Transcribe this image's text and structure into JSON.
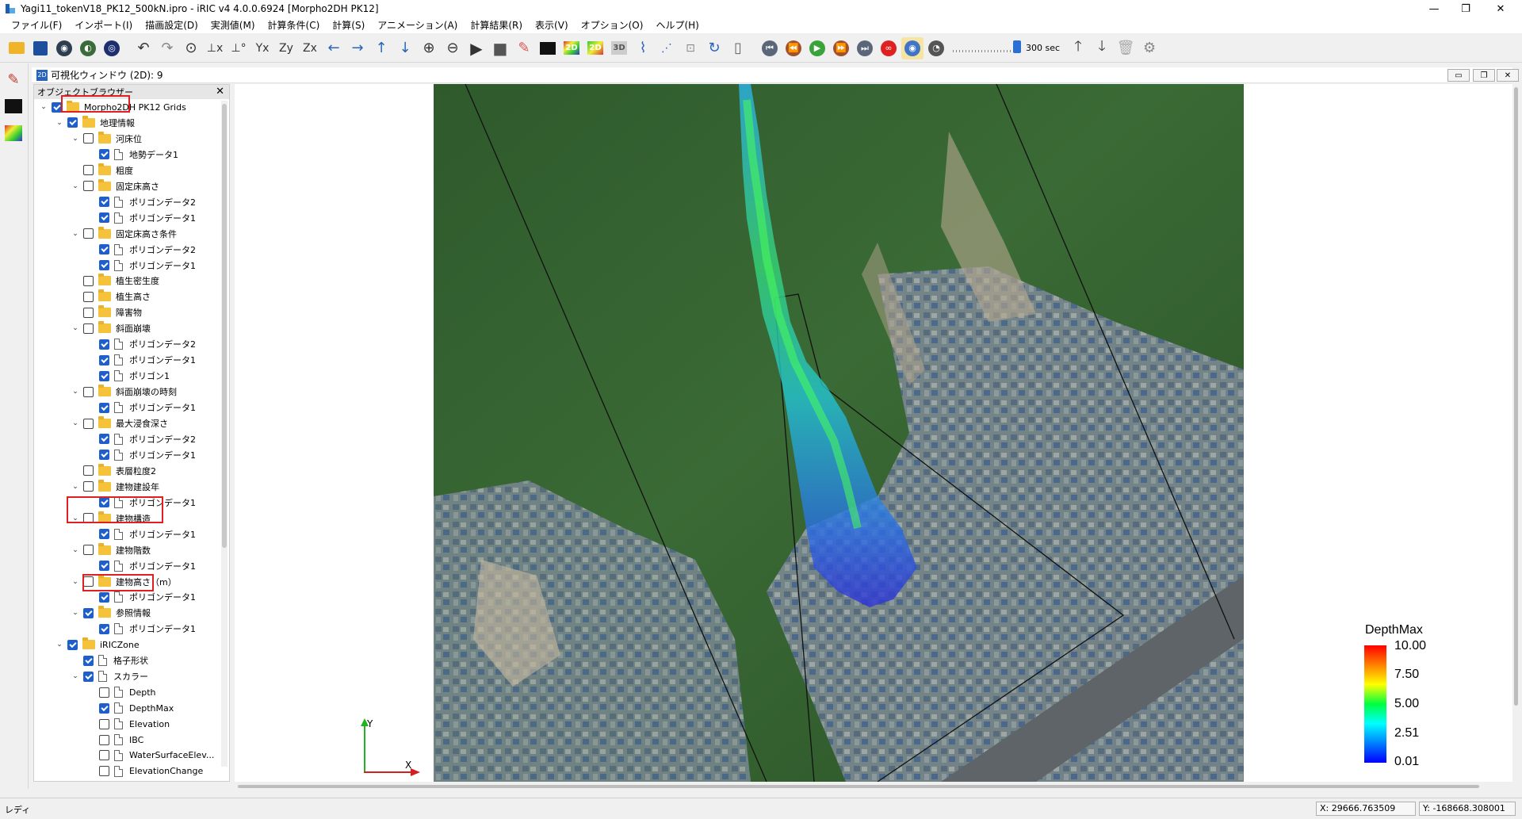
{
  "window": {
    "title": "Yagi11_tokenV18_PK12_500kN.ipro - iRIC v4 4.0.0.6924 [Morpho2DH PK12]",
    "minimize": "—",
    "maximize": "❐",
    "close": "✕"
  },
  "menu": [
    "ファイル(F)",
    "インポート(I)",
    "描画設定(D)",
    "実測値(M)",
    "計算条件(C)",
    "計算(S)",
    "アニメーション(A)",
    "計算結果(R)",
    "表示(V)",
    "オプション(O)",
    "ヘルプ(H)"
  ],
  "toolbar": {
    "time_label": "300 sec",
    "slider_fraction": 0.9
  },
  "subwindow": {
    "title": "可視化ウィンドウ (2D): 9",
    "badge": "2D"
  },
  "object_browser": {
    "title": "オブジェクトブラウザー",
    "close": "✕",
    "rows": [
      {
        "label": "Morpho2DH PK12 Grids",
        "level": 0,
        "arrow": true,
        "checked": true,
        "icon": "folder"
      },
      {
        "label": "地理情報",
        "level": 1,
        "arrow": true,
        "checked": true,
        "icon": "folder"
      },
      {
        "label": "河床位",
        "level": 2,
        "arrow": true,
        "checked": false,
        "icon": "folder"
      },
      {
        "label": "地勢データ1",
        "level": 3,
        "arrow": false,
        "checked": true,
        "icon": "doc"
      },
      {
        "label": "粗度",
        "level": 2,
        "arrow": false,
        "checked": false,
        "icon": "folder"
      },
      {
        "label": "固定床高さ",
        "level": 2,
        "arrow": true,
        "checked": false,
        "icon": "folder"
      },
      {
        "label": "ポリゴンデータ2",
        "level": 3,
        "arrow": false,
        "checked": true,
        "icon": "doc"
      },
      {
        "label": "ポリゴンデータ1",
        "level": 3,
        "arrow": false,
        "checked": true,
        "icon": "doc"
      },
      {
        "label": "固定床高さ条件",
        "level": 2,
        "arrow": true,
        "checked": false,
        "icon": "folder"
      },
      {
        "label": "ポリゴンデータ2",
        "level": 3,
        "arrow": false,
        "checked": true,
        "icon": "doc"
      },
      {
        "label": "ポリゴンデータ1",
        "level": 3,
        "arrow": false,
        "checked": true,
        "icon": "doc"
      },
      {
        "label": "植生密生度",
        "level": 2,
        "arrow": false,
        "checked": false,
        "icon": "folder"
      },
      {
        "label": "植生高さ",
        "level": 2,
        "arrow": false,
        "checked": false,
        "icon": "folder"
      },
      {
        "label": "障害物",
        "level": 2,
        "arrow": false,
        "checked": false,
        "icon": "folder"
      },
      {
        "label": "斜面崩壊",
        "level": 2,
        "arrow": true,
        "checked": false,
        "icon": "folder"
      },
      {
        "label": "ポリゴンデータ2",
        "level": 3,
        "arrow": false,
        "checked": true,
        "icon": "doc"
      },
      {
        "label": "ポリゴンデータ1",
        "level": 3,
        "arrow": false,
        "checked": true,
        "icon": "doc"
      },
      {
        "label": "ポリゴン1",
        "level": 3,
        "arrow": false,
        "checked": true,
        "icon": "doc"
      },
      {
        "label": "斜面崩壊の時刻",
        "level": 2,
        "arrow": true,
        "checked": false,
        "icon": "folder"
      },
      {
        "label": "ポリゴンデータ1",
        "level": 3,
        "arrow": false,
        "checked": true,
        "icon": "doc"
      },
      {
        "label": "最大浸食深さ",
        "level": 2,
        "arrow": true,
        "checked": false,
        "icon": "folder"
      },
      {
        "label": "ポリゴンデータ2",
        "level": 3,
        "arrow": false,
        "checked": true,
        "icon": "doc"
      },
      {
        "label": "ポリゴンデータ1",
        "level": 3,
        "arrow": false,
        "checked": true,
        "icon": "doc"
      },
      {
        "label": "表層粒度2",
        "level": 2,
        "arrow": false,
        "checked": false,
        "icon": "folder"
      },
      {
        "label": "建物建設年",
        "level": 2,
        "arrow": true,
        "checked": false,
        "icon": "folder"
      },
      {
        "label": "ポリゴンデータ1",
        "level": 3,
        "arrow": false,
        "checked": true,
        "icon": "doc"
      },
      {
        "label": "建物構造",
        "level": 2,
        "arrow": true,
        "checked": false,
        "icon": "folder"
      },
      {
        "label": "ポリゴンデータ1",
        "level": 3,
        "arrow": false,
        "checked": true,
        "icon": "doc"
      },
      {
        "label": "建物階数",
        "level": 2,
        "arrow": true,
        "checked": false,
        "icon": "folder"
      },
      {
        "label": "ポリゴンデータ1",
        "level": 3,
        "arrow": false,
        "checked": true,
        "icon": "doc"
      },
      {
        "label": "建物高さ（m）",
        "level": 2,
        "arrow": true,
        "checked": false,
        "icon": "folder"
      },
      {
        "label": "ポリゴンデータ1",
        "level": 3,
        "arrow": false,
        "checked": true,
        "icon": "doc"
      },
      {
        "label": "参照情報",
        "level": 2,
        "arrow": true,
        "checked": true,
        "icon": "folder"
      },
      {
        "label": "ポリゴンデータ1",
        "level": 3,
        "arrow": false,
        "checked": true,
        "icon": "doc"
      },
      {
        "label": "iRICZone",
        "level": 1,
        "arrow": true,
        "checked": true,
        "icon": "folder"
      },
      {
        "label": "格子形状",
        "level": 2,
        "arrow": false,
        "checked": true,
        "icon": "doc"
      },
      {
        "label": "スカラー",
        "level": 2,
        "arrow": true,
        "checked": true,
        "icon": "doc"
      },
      {
        "label": "Depth",
        "level": 3,
        "arrow": false,
        "checked": false,
        "icon": "doc"
      },
      {
        "label": "DepthMax",
        "level": 3,
        "arrow": false,
        "checked": true,
        "icon": "doc"
      },
      {
        "label": "Elevation",
        "level": 3,
        "arrow": false,
        "checked": false,
        "icon": "doc"
      },
      {
        "label": "IBC",
        "level": 3,
        "arrow": false,
        "checked": false,
        "icon": "doc"
      },
      {
        "label": "WaterSurfaceElev...",
        "level": 3,
        "arrow": false,
        "checked": false,
        "icon": "doc"
      },
      {
        "label": "ElevationChange",
        "level": 3,
        "arrow": false,
        "checked": false,
        "icon": "doc"
      }
    ]
  },
  "legend": {
    "title": "DepthMax",
    "ticks": [
      "10.00",
      "7.50",
      "5.00",
      "2.51",
      "0.01"
    ],
    "colors": [
      "#ff0000",
      "#ffff00",
      "#00ff40",
      "#00ffff",
      "#0000ff"
    ]
  },
  "axes": {
    "x": "X",
    "y": "Y"
  },
  "status": {
    "text": "レディ",
    "x": "X: 29666.763509",
    "y": "Y: -168668.308001"
  }
}
